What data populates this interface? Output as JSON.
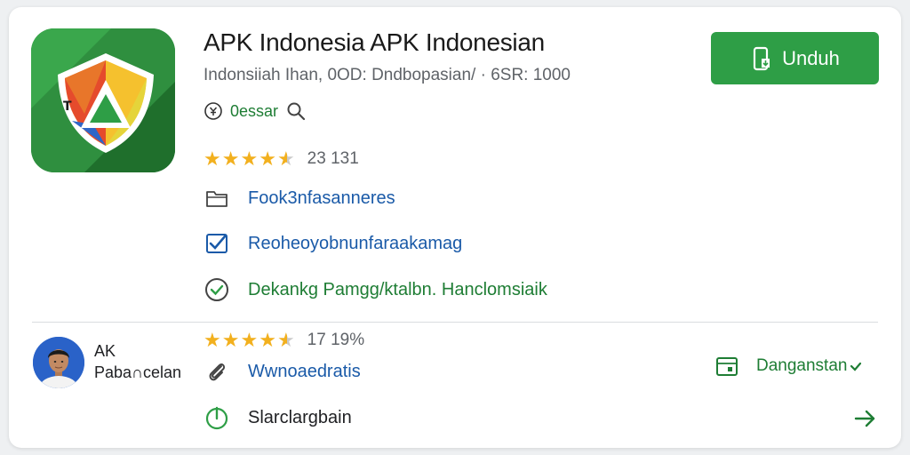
{
  "app": {
    "title": "APK Indonesia APK Indonesian",
    "subtitle": "Indonsiiah Ihan, 0OD: Dndbopasian/ · 6SR: 1000",
    "developer": "0essar",
    "rating_count": "23 131",
    "rating_value": 4.5,
    "icon": "triangle-shield-logo"
  },
  "actions": {
    "download_label": "Unduh",
    "download_icon": "phone-download-icon"
  },
  "features": [
    {
      "icon": "folder-icon",
      "label": "Fook3nfasanneres"
    },
    {
      "icon": "checkbox-icon",
      "label": "Reoheoyobnunfaraakamag"
    },
    {
      "icon": "check-circle-icon",
      "label": "Dekankg Pamgg/ktalbn. Hanclomsiaik"
    }
  ],
  "review": {
    "reviewer_name": "AK Paba∩celan",
    "rating_text": "17 19%",
    "rating_value": 4.5,
    "line1": "Wwnoaedratis",
    "line2": "Slarclargbain",
    "tag_label": "Danganstan",
    "tag_icon": "calendar-icon"
  },
  "colors": {
    "accent_green": "#2e9e46",
    "text_green": "#1e7d34",
    "link_blue": "#1a5aa8",
    "star": "#f2b01e"
  }
}
